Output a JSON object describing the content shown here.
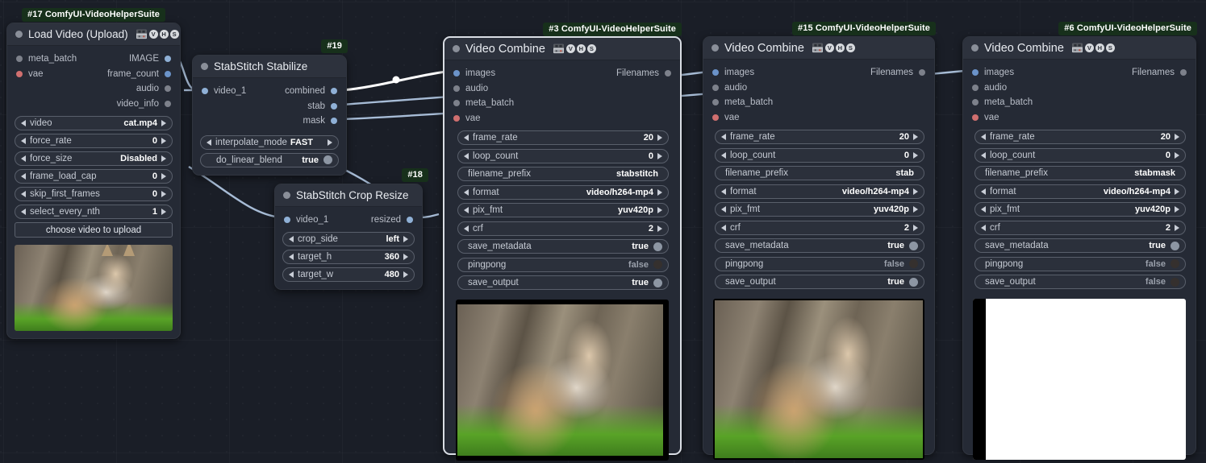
{
  "app": {
    "name": "ComfyUI Node Graph",
    "background_color": "#1a1e27",
    "node_color": "#252a35",
    "title_color": "#2d323d",
    "badge_color": "#17301b",
    "accent_link_color": "#a7bcd6",
    "highlight_link_color": "#ffffff"
  },
  "nodes": [
    {
      "id": "n17",
      "badge": "#17 ComfyUI-VideoHelperSuite",
      "title": "Load Video (Upload)",
      "icons": [
        "vhs-tape-icon",
        "v-badge-icon",
        "h-badge-icon",
        "s-badge-icon"
      ],
      "inputs": [
        {
          "label": "meta_batch",
          "dot": "grey"
        },
        {
          "label": "vae",
          "dot": "red"
        }
      ],
      "outputs": [
        {
          "label": "IMAGE",
          "dot": "lblue"
        },
        {
          "label": "frame_count",
          "dot": "blue"
        },
        {
          "label": "audio",
          "dot": "grey"
        },
        {
          "label": "video_info",
          "dot": "grey"
        }
      ],
      "widgets": [
        {
          "type": "combo",
          "name": "video",
          "value": "cat.mp4"
        },
        {
          "type": "combo",
          "name": "force_rate",
          "value": "0"
        },
        {
          "type": "combo",
          "name": "force_size",
          "value": "Disabled"
        },
        {
          "type": "combo",
          "name": "frame_load_cap",
          "value": "0"
        },
        {
          "type": "combo",
          "name": "skip_first_frames",
          "value": "0"
        },
        {
          "type": "combo",
          "name": "select_every_nth",
          "value": "1"
        },
        {
          "type": "button",
          "name": "choose video to upload"
        }
      ],
      "preview": "lynx-photo"
    },
    {
      "id": "n19",
      "badge": "#19",
      "title": "StabStitch Stabilize",
      "icons": [],
      "inputs": [
        {
          "label": "video_1",
          "dot": "lblue"
        }
      ],
      "outputs": [
        {
          "label": "combined",
          "dot": "lblue"
        },
        {
          "label": "stab",
          "dot": "lblue"
        },
        {
          "label": "mask",
          "dot": "lblue"
        }
      ],
      "widgets": [
        {
          "type": "combo",
          "name": "interpolate_mode",
          "value": "FAST"
        },
        {
          "type": "toggle",
          "name": "do_linear_blend",
          "value": "true",
          "on": true
        }
      ],
      "preview": null
    },
    {
      "id": "n18",
      "badge": "#18",
      "title": "StabStitch Crop Resize",
      "icons": [],
      "inputs": [
        {
          "label": "video_1",
          "dot": "lblue"
        }
      ],
      "outputs": [
        {
          "label": "resized",
          "dot": "lblue"
        }
      ],
      "widgets": [
        {
          "type": "combo",
          "name": "crop_side",
          "value": "left"
        },
        {
          "type": "combo",
          "name": "target_h",
          "value": "360"
        },
        {
          "type": "combo",
          "name": "target_w",
          "value": "480"
        }
      ],
      "preview": null
    },
    {
      "id": "n3",
      "badge": "#3 ComfyUI-VideoHelperSuite",
      "title": "Video Combine",
      "icons": [
        "vhs-tape-icon",
        "v-badge-icon",
        "h-badge-icon",
        "s-badge-icon"
      ],
      "selected": true,
      "inputs": [
        {
          "label": "images",
          "dot": "blue"
        },
        {
          "label": "audio",
          "dot": "grey"
        },
        {
          "label": "meta_batch",
          "dot": "grey"
        },
        {
          "label": "vae",
          "dot": "red"
        }
      ],
      "outputs": [
        {
          "label": "Filenames",
          "dot": "grey"
        }
      ],
      "widgets": [
        {
          "type": "combo",
          "name": "frame_rate",
          "value": "20"
        },
        {
          "type": "combo",
          "name": "loop_count",
          "value": "0"
        },
        {
          "type": "text",
          "name": "filename_prefix",
          "value": "stabstitch"
        },
        {
          "type": "combo",
          "name": "format",
          "value": "video/h264-mp4"
        },
        {
          "type": "combo",
          "name": "pix_fmt",
          "value": "yuv420p"
        },
        {
          "type": "combo",
          "name": "crf",
          "value": "2"
        },
        {
          "type": "toggle",
          "name": "save_metadata",
          "value": "true",
          "on": true
        },
        {
          "type": "toggle",
          "name": "pingpong",
          "value": "false",
          "on": false
        },
        {
          "type": "toggle",
          "name": "save_output",
          "value": "true",
          "on": true
        }
      ],
      "preview": "lynx-photo"
    },
    {
      "id": "n15",
      "badge": "#15 ComfyUI-VideoHelperSuite",
      "title": "Video Combine",
      "icons": [
        "vhs-tape-icon",
        "v-badge-icon",
        "h-badge-icon",
        "s-badge-icon"
      ],
      "inputs": [
        {
          "label": "images",
          "dot": "blue"
        },
        {
          "label": "audio",
          "dot": "grey"
        },
        {
          "label": "meta_batch",
          "dot": "grey"
        },
        {
          "label": "vae",
          "dot": "red"
        }
      ],
      "outputs": [
        {
          "label": "Filenames",
          "dot": "grey"
        }
      ],
      "widgets": [
        {
          "type": "combo",
          "name": "frame_rate",
          "value": "20"
        },
        {
          "type": "combo",
          "name": "loop_count",
          "value": "0"
        },
        {
          "type": "text",
          "name": "filename_prefix",
          "value": "stab"
        },
        {
          "type": "combo",
          "name": "format",
          "value": "video/h264-mp4"
        },
        {
          "type": "combo",
          "name": "pix_fmt",
          "value": "yuv420p"
        },
        {
          "type": "combo",
          "name": "crf",
          "value": "2"
        },
        {
          "type": "toggle",
          "name": "save_metadata",
          "value": "true",
          "on": true
        },
        {
          "type": "toggle",
          "name": "pingpong",
          "value": "false",
          "on": false
        },
        {
          "type": "toggle",
          "name": "save_output",
          "value": "true",
          "on": true
        }
      ],
      "preview": "lynx-photo"
    },
    {
      "id": "n6",
      "badge": "#6 ComfyUI-VideoHelperSuite",
      "title": "Video Combine",
      "icons": [
        "vhs-tape-icon",
        "v-badge-icon",
        "h-badge-icon",
        "s-badge-icon"
      ],
      "inputs": [
        {
          "label": "images",
          "dot": "blue"
        },
        {
          "label": "audio",
          "dot": "grey"
        },
        {
          "label": "meta_batch",
          "dot": "grey"
        },
        {
          "label": "vae",
          "dot": "red"
        }
      ],
      "outputs": [
        {
          "label": "Filenames",
          "dot": "grey"
        }
      ],
      "widgets": [
        {
          "type": "combo",
          "name": "frame_rate",
          "value": "20"
        },
        {
          "type": "combo",
          "name": "loop_count",
          "value": "0"
        },
        {
          "type": "text",
          "name": "filename_prefix",
          "value": "stabmask"
        },
        {
          "type": "combo",
          "name": "format",
          "value": "video/h264-mp4"
        },
        {
          "type": "combo",
          "name": "pix_fmt",
          "value": "yuv420p"
        },
        {
          "type": "combo",
          "name": "crf",
          "value": "2"
        },
        {
          "type": "toggle",
          "name": "save_metadata",
          "value": "true",
          "on": true
        },
        {
          "type": "toggle",
          "name": "pingpong",
          "value": "false",
          "on": false
        },
        {
          "type": "toggle",
          "name": "save_output",
          "value": "false",
          "on": false
        }
      ],
      "preview": "mask-white"
    }
  ]
}
